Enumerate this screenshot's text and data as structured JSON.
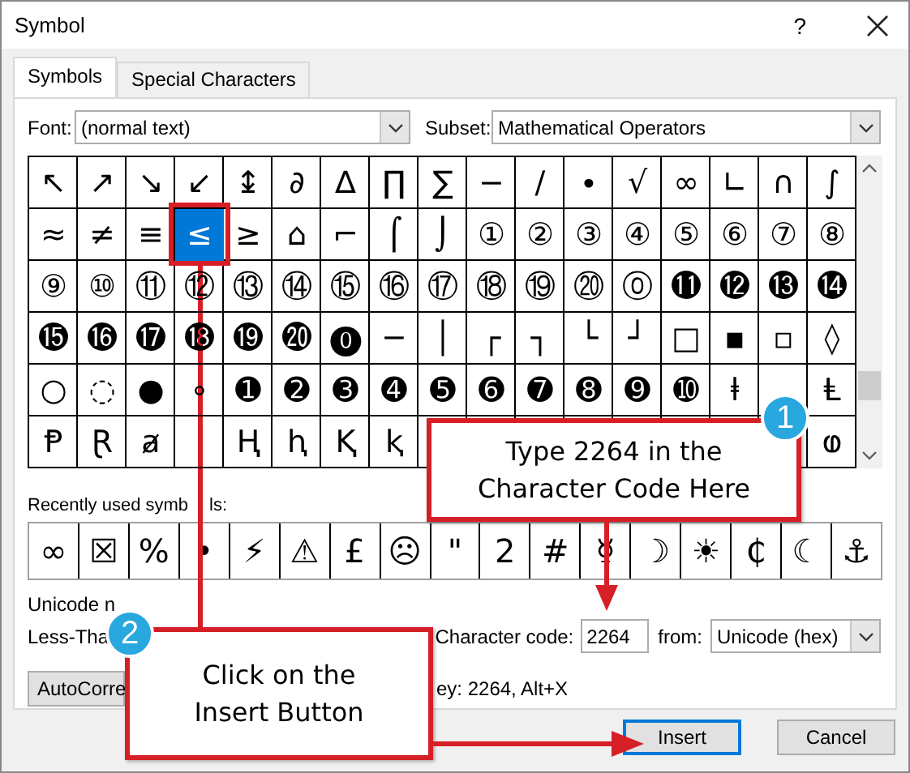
{
  "window": {
    "title": "Symbol",
    "help": "?"
  },
  "tabs": [
    {
      "label": "Symbols",
      "selected": true
    },
    {
      "label": "Special Characters",
      "selected": false
    }
  ],
  "font": {
    "label": "Font:",
    "value": "(normal text)"
  },
  "subset": {
    "label": "Subset:",
    "value": "Mathematical Operators"
  },
  "grid": {
    "rows": [
      [
        {
          "char": "↖",
          "selected": false
        },
        {
          "char": "↗",
          "selected": false
        },
        {
          "char": "↘",
          "selected": false
        },
        {
          "char": "↙",
          "selected": false
        },
        {
          "char": "↨",
          "selected": false
        },
        {
          "char": "∂",
          "selected": false
        },
        {
          "char": "∆",
          "selected": false
        },
        {
          "char": "∏",
          "selected": false
        },
        {
          "char": "∑",
          "selected": false
        },
        {
          "char": "−",
          "selected": false
        },
        {
          "char": "∕",
          "selected": false
        },
        {
          "char": "∙",
          "selected": false
        },
        {
          "char": "√",
          "selected": false
        },
        {
          "char": "∞",
          "selected": false
        },
        {
          "char": "∟",
          "selected": false
        },
        {
          "char": "∩",
          "selected": false
        },
        {
          "char": "∫",
          "selected": false
        }
      ],
      [
        {
          "char": "≈",
          "selected": false
        },
        {
          "char": "≠",
          "selected": false
        },
        {
          "char": "≡",
          "selected": false
        },
        {
          "char": "≤",
          "selected": true
        },
        {
          "char": "≥",
          "selected": false
        },
        {
          "char": "⌂",
          "selected": false
        },
        {
          "char": "⌐",
          "selected": false
        },
        {
          "char": "⌠",
          "selected": false
        },
        {
          "char": "⌡",
          "selected": false
        },
        {
          "char": "①",
          "selected": false
        },
        {
          "char": "②",
          "selected": false
        },
        {
          "char": "③",
          "selected": false
        },
        {
          "char": "④",
          "selected": false
        },
        {
          "char": "⑤",
          "selected": false
        },
        {
          "char": "⑥",
          "selected": false
        },
        {
          "char": "⑦",
          "selected": false
        },
        {
          "char": "⑧",
          "selected": false
        }
      ],
      [
        {
          "char": "⑨",
          "selected": false
        },
        {
          "char": "⑩",
          "selected": false
        },
        {
          "char": "⑪",
          "selected": false
        },
        {
          "char": "⑫",
          "selected": false
        },
        {
          "char": "⑬",
          "selected": false
        },
        {
          "char": "⑭",
          "selected": false
        },
        {
          "char": "⑮",
          "selected": false
        },
        {
          "char": "⑯",
          "selected": false
        },
        {
          "char": "⑰",
          "selected": false
        },
        {
          "char": "⑱",
          "selected": false
        },
        {
          "char": "⑲",
          "selected": false
        },
        {
          "char": "⑳",
          "selected": false
        },
        {
          "char": "⓪",
          "selected": false
        },
        {
          "char": "⓫",
          "selected": false
        },
        {
          "char": "⓬",
          "selected": false
        },
        {
          "char": "⓭",
          "selected": false
        },
        {
          "char": "⓮",
          "selected": false
        }
      ],
      [
        {
          "char": "⓯",
          "selected": false
        },
        {
          "char": "⓰",
          "selected": false
        },
        {
          "char": "⓱",
          "selected": false
        },
        {
          "char": "⓲",
          "selected": false
        },
        {
          "char": "⓳",
          "selected": false
        },
        {
          "char": "⓴",
          "selected": false
        },
        {
          "char": "⓿",
          "selected": false
        },
        {
          "char": "─",
          "selected": false
        },
        {
          "char": "│",
          "selected": false
        },
        {
          "char": "┌",
          "selected": false
        },
        {
          "char": "┐",
          "selected": false
        },
        {
          "char": "└",
          "selected": false
        },
        {
          "char": "┘",
          "selected": false
        },
        {
          "char": "□",
          "selected": false
        },
        {
          "char": "▪",
          "selected": false
        },
        {
          "char": "▫",
          "selected": false
        },
        {
          "char": "◊",
          "selected": false
        }
      ],
      [
        {
          "char": "○",
          "selected": false
        },
        {
          "char": "◌",
          "selected": false
        },
        {
          "char": "●",
          "selected": false
        },
        {
          "char": "∘",
          "selected": false
        },
        {
          "char": "➊",
          "selected": false
        },
        {
          "char": "➋",
          "selected": false
        },
        {
          "char": "➌",
          "selected": false
        },
        {
          "char": "➍",
          "selected": false
        },
        {
          "char": "➎",
          "selected": false
        },
        {
          "char": "➏",
          "selected": false
        },
        {
          "char": "➐",
          "selected": false
        },
        {
          "char": "➑",
          "selected": false
        },
        {
          "char": "➒",
          "selected": false
        },
        {
          "char": "➓",
          "selected": false
        },
        {
          "char": "ⱡ",
          "selected": false
        },
        null,
        {
          "char": "Ⱡ",
          "selected": false
        }
      ],
      [
        {
          "char": "Ᵽ",
          "selected": false
        },
        {
          "char": "Ɽ",
          "selected": false
        },
        {
          "char": "ⱥ",
          "selected": false
        },
        null,
        {
          "char": "Ⱨ",
          "selected": false
        },
        {
          "char": "ⱨ",
          "selected": false
        },
        {
          "char": "Ⱪ",
          "selected": false
        },
        {
          "char": "ⱪ",
          "selected": false
        },
        null,
        null,
        null,
        null,
        null,
        null,
        null,
        null,
        {
          "char": "ⱷ",
          "selected": false
        }
      ]
    ]
  },
  "recent": {
    "label_parts": [
      "Recently used symb",
      "ls:"
    ],
    "symbols": [
      "∞",
      "☒",
      "%",
      "•",
      "⚡",
      "⚠",
      "£",
      "☹",
      "\"",
      "2",
      "#",
      "☿",
      "☽",
      "☀",
      "₵",
      "☾",
      "⚓"
    ]
  },
  "unicode_name": {
    "label": "Unicode n",
    "value": "Less-Tha"
  },
  "character_code": {
    "label": "Character code:",
    "value": "2264"
  },
  "from": {
    "label": "from:",
    "value": "Unicode (hex)"
  },
  "autocorrect_button": "AutoCorre",
  "shortcut_key": "ey: 2264, Alt+X",
  "buttons": [
    {
      "label": "Insert",
      "default": true
    },
    {
      "label": "Cancel",
      "default": false
    }
  ],
  "callouts": [
    {
      "number": "1",
      "text": "Type 2264 in the Character Code Here"
    },
    {
      "number": "2",
      "text": "Click on the Insert Button"
    }
  ]
}
